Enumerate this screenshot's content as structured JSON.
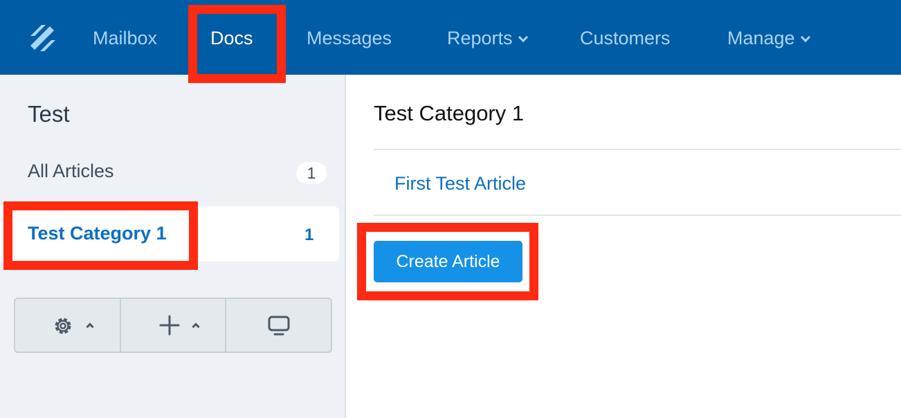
{
  "nav": {
    "items": [
      {
        "label": "Mailbox",
        "active": false,
        "dropdown": false
      },
      {
        "label": "Docs",
        "active": true,
        "dropdown": false
      },
      {
        "label": "Messages",
        "active": false,
        "dropdown": false
      },
      {
        "label": "Reports",
        "active": false,
        "dropdown": true
      },
      {
        "label": "Customers",
        "active": false,
        "dropdown": false
      },
      {
        "label": "Manage",
        "active": false,
        "dropdown": true
      }
    ]
  },
  "sidebar": {
    "title": "Test",
    "all_articles": {
      "label": "All Articles",
      "count": "1"
    },
    "categories": [
      {
        "label": "Test Category 1",
        "count": "1",
        "selected": true
      }
    ],
    "toolbar": [
      "gear-icon",
      "plus-icon",
      "monitor-icon"
    ]
  },
  "main": {
    "category_title": "Test Category 1",
    "articles": [
      "First Test Article"
    ],
    "create_label": "Create Article"
  },
  "colors": {
    "topbar": "#005ca4",
    "accent": "#1591e8",
    "link": "#0a6fc2",
    "highlight": "#ff2a12"
  }
}
